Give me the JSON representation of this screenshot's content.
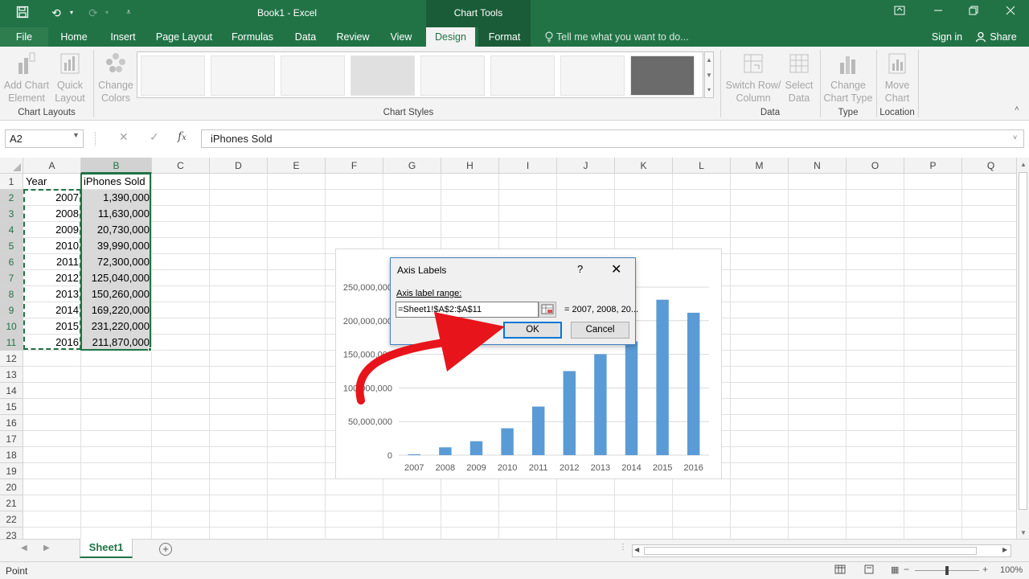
{
  "window": {
    "title": "Book1 - Excel",
    "context_tab": "Chart Tools",
    "accent": "#217346"
  },
  "menu": {
    "tabs": [
      "File",
      "Home",
      "Insert",
      "Page Layout",
      "Formulas",
      "Data",
      "Review",
      "View",
      "Design",
      "Format"
    ],
    "tell_me": "Tell me what you want to do...",
    "sign_in": "Sign in",
    "share": "Share"
  },
  "ribbon": {
    "add_chart_element": [
      "Add Chart",
      "Element"
    ],
    "quick_layout": [
      "Quick",
      "Layout"
    ],
    "change_colors": [
      "Change",
      "Colors"
    ],
    "switch_row_col": [
      "Switch Row/",
      "Column"
    ],
    "select_data": [
      "Select",
      "Data"
    ],
    "change_chart_type": [
      "Change",
      "Chart Type"
    ],
    "move_chart": [
      "Move",
      "Chart"
    ],
    "groups": {
      "chart_layouts": "Chart Layouts",
      "chart_styles": "Chart Styles",
      "data": "Data",
      "type": "Type",
      "location": "Location"
    }
  },
  "formula_bar": {
    "name_box": "A2",
    "formula": "iPhones Sold"
  },
  "sheet": {
    "columns": [
      "A",
      "B",
      "C",
      "D",
      "E",
      "F",
      "G",
      "H",
      "I",
      "J",
      "K",
      "L",
      "M",
      "N",
      "O",
      "P",
      "Q"
    ],
    "rows": [
      "1",
      "2",
      "3",
      "4",
      "5",
      "6",
      "7",
      "8",
      "9",
      "10",
      "11",
      "12",
      "13",
      "14",
      "15",
      "16",
      "17",
      "18",
      "19",
      "20",
      "21",
      "22",
      "23"
    ],
    "header": [
      "Year",
      "iPhones Sold"
    ],
    "years": [
      "2007",
      "2008",
      "2009",
      "2010",
      "2011",
      "2012",
      "2013",
      "2014",
      "2015",
      "2016"
    ],
    "sold": [
      "1,390,000",
      "11,630,000",
      "20,730,000",
      "39,990,000",
      "72,300,000",
      "125,040,000",
      "150,260,000",
      "169,220,000",
      "231,220,000",
      "211,870,000"
    ],
    "tab_name": "Sheet1"
  },
  "chart_data": {
    "type": "bar",
    "categories": [
      "2007",
      "2008",
      "2009",
      "2010",
      "2011",
      "2012",
      "2013",
      "2014",
      "2015",
      "2016"
    ],
    "values": [
      1390000,
      11630000,
      20730000,
      39990000,
      72300000,
      125040000,
      150260000,
      169220000,
      231220000,
      211870000
    ],
    "ylim": [
      0,
      250000000
    ],
    "yticks": [
      "0",
      "50,000,000",
      "100,000,000",
      "150,000,000",
      "200,000,000",
      "250,000,000"
    ],
    "ytick_values": [
      0,
      50000000,
      100000000,
      150000000,
      200000000,
      250000000
    ],
    "bar_color": "#5b9bd5",
    "grid": true
  },
  "dialog": {
    "title": "Axis Labels",
    "help": "?",
    "close": "✕",
    "field_label": "Axis label range:",
    "value": "=Sheet1!$A$2:$A$11",
    "preview": "= 2007, 2008, 20...",
    "ok": "OK",
    "cancel": "Cancel"
  },
  "annotation": {
    "arrow_color": "#e8141b"
  },
  "status": {
    "mode": "Point",
    "zoom": "100%"
  }
}
